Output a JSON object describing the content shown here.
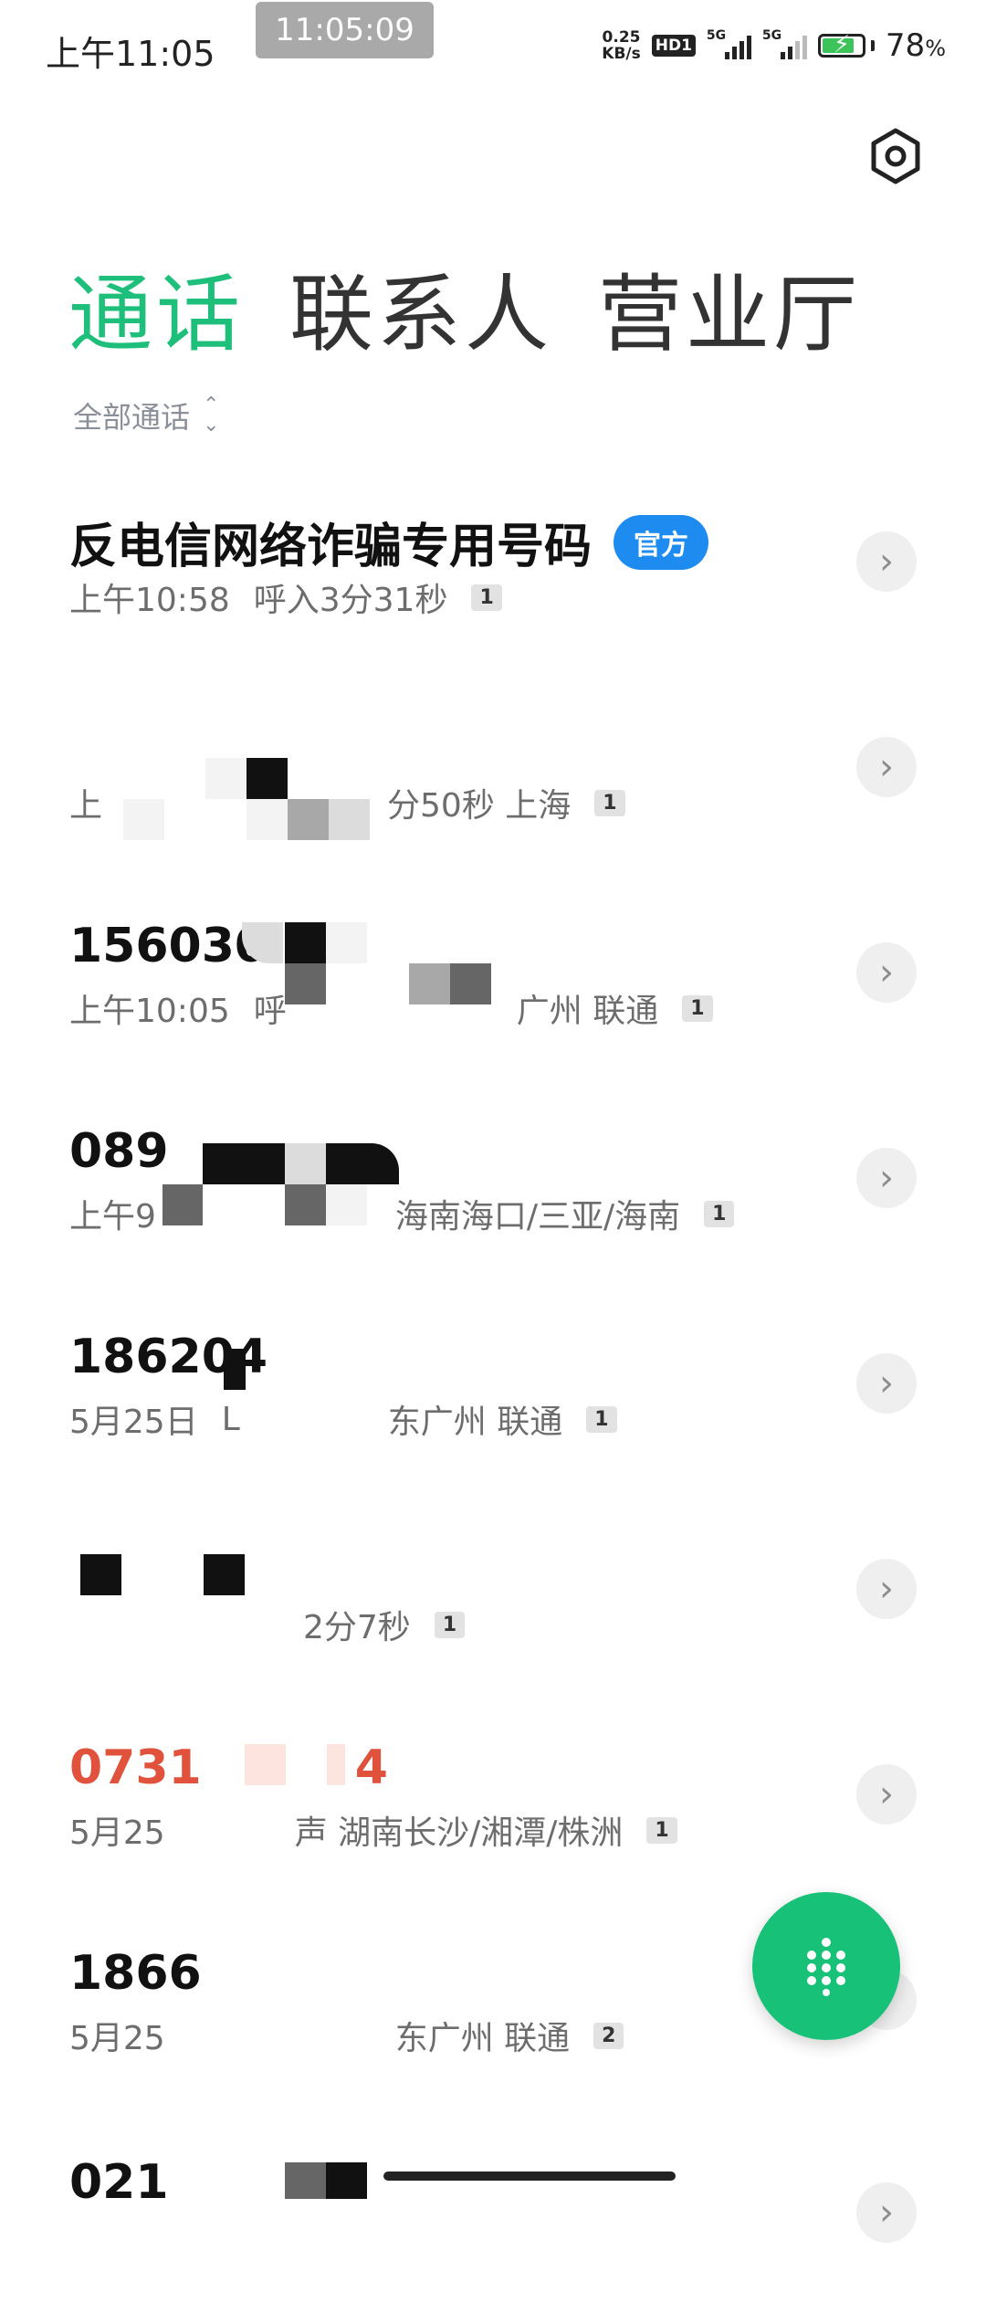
{
  "status_bar": {
    "time": "上午11:05",
    "clock_overlay": "11:05:09",
    "net_speed_value": "0.25",
    "net_speed_unit": "KB/s",
    "hd_label": "HD1",
    "signal_label_1": "5G",
    "signal_label_2": "5G",
    "battery_percent": "78",
    "battery_percent_sign": "%"
  },
  "tabs": [
    {
      "label": "通话",
      "active": true
    },
    {
      "label": "联系人",
      "active": false
    },
    {
      "label": "营业厅",
      "active": false
    }
  ],
  "filter": {
    "label": "全部通话"
  },
  "calls": [
    {
      "name": "反电信网络诈骗专用号码",
      "official_badge": "官方",
      "time": "上午10:58",
      "detail": "呼入3分31秒",
      "count": "1"
    },
    {
      "name": "",
      "time": "上",
      "detail": "分50秒 上海",
      "count": "1"
    },
    {
      "name": "156030",
      "time": "上午10:05",
      "detail": "呼",
      "location": "广州 联通",
      "count": "1"
    },
    {
      "name": "089",
      "time": "上午9",
      "detail": "海南海口/三亚/海南",
      "count": "1"
    },
    {
      "name": "186204",
      "time": "5月25日",
      "detail": "L",
      "location": "东广州 联通",
      "count": "1"
    },
    {
      "name": "",
      "time": "",
      "detail": "2分7秒",
      "count": "1"
    },
    {
      "name": "0731",
      "name_suffix": "4",
      "missed": true,
      "time": "5月25",
      "detail": "声 湖南长沙/湘潭/株洲",
      "count": "1"
    },
    {
      "name": "1866",
      "time": "5月25",
      "detail": "东广州 联通",
      "count": "2"
    },
    {
      "name": "021",
      "time": "",
      "detail": "",
      "count": ""
    }
  ],
  "colors": {
    "accent": "#1dbf7a",
    "missed": "#e0523b",
    "official": "#1e8bf0",
    "fab": "#17c177"
  },
  "icons": {
    "settings": "gear-icon",
    "dialpad": "dialpad-icon",
    "row_arrow": "chevron-right-icon"
  }
}
